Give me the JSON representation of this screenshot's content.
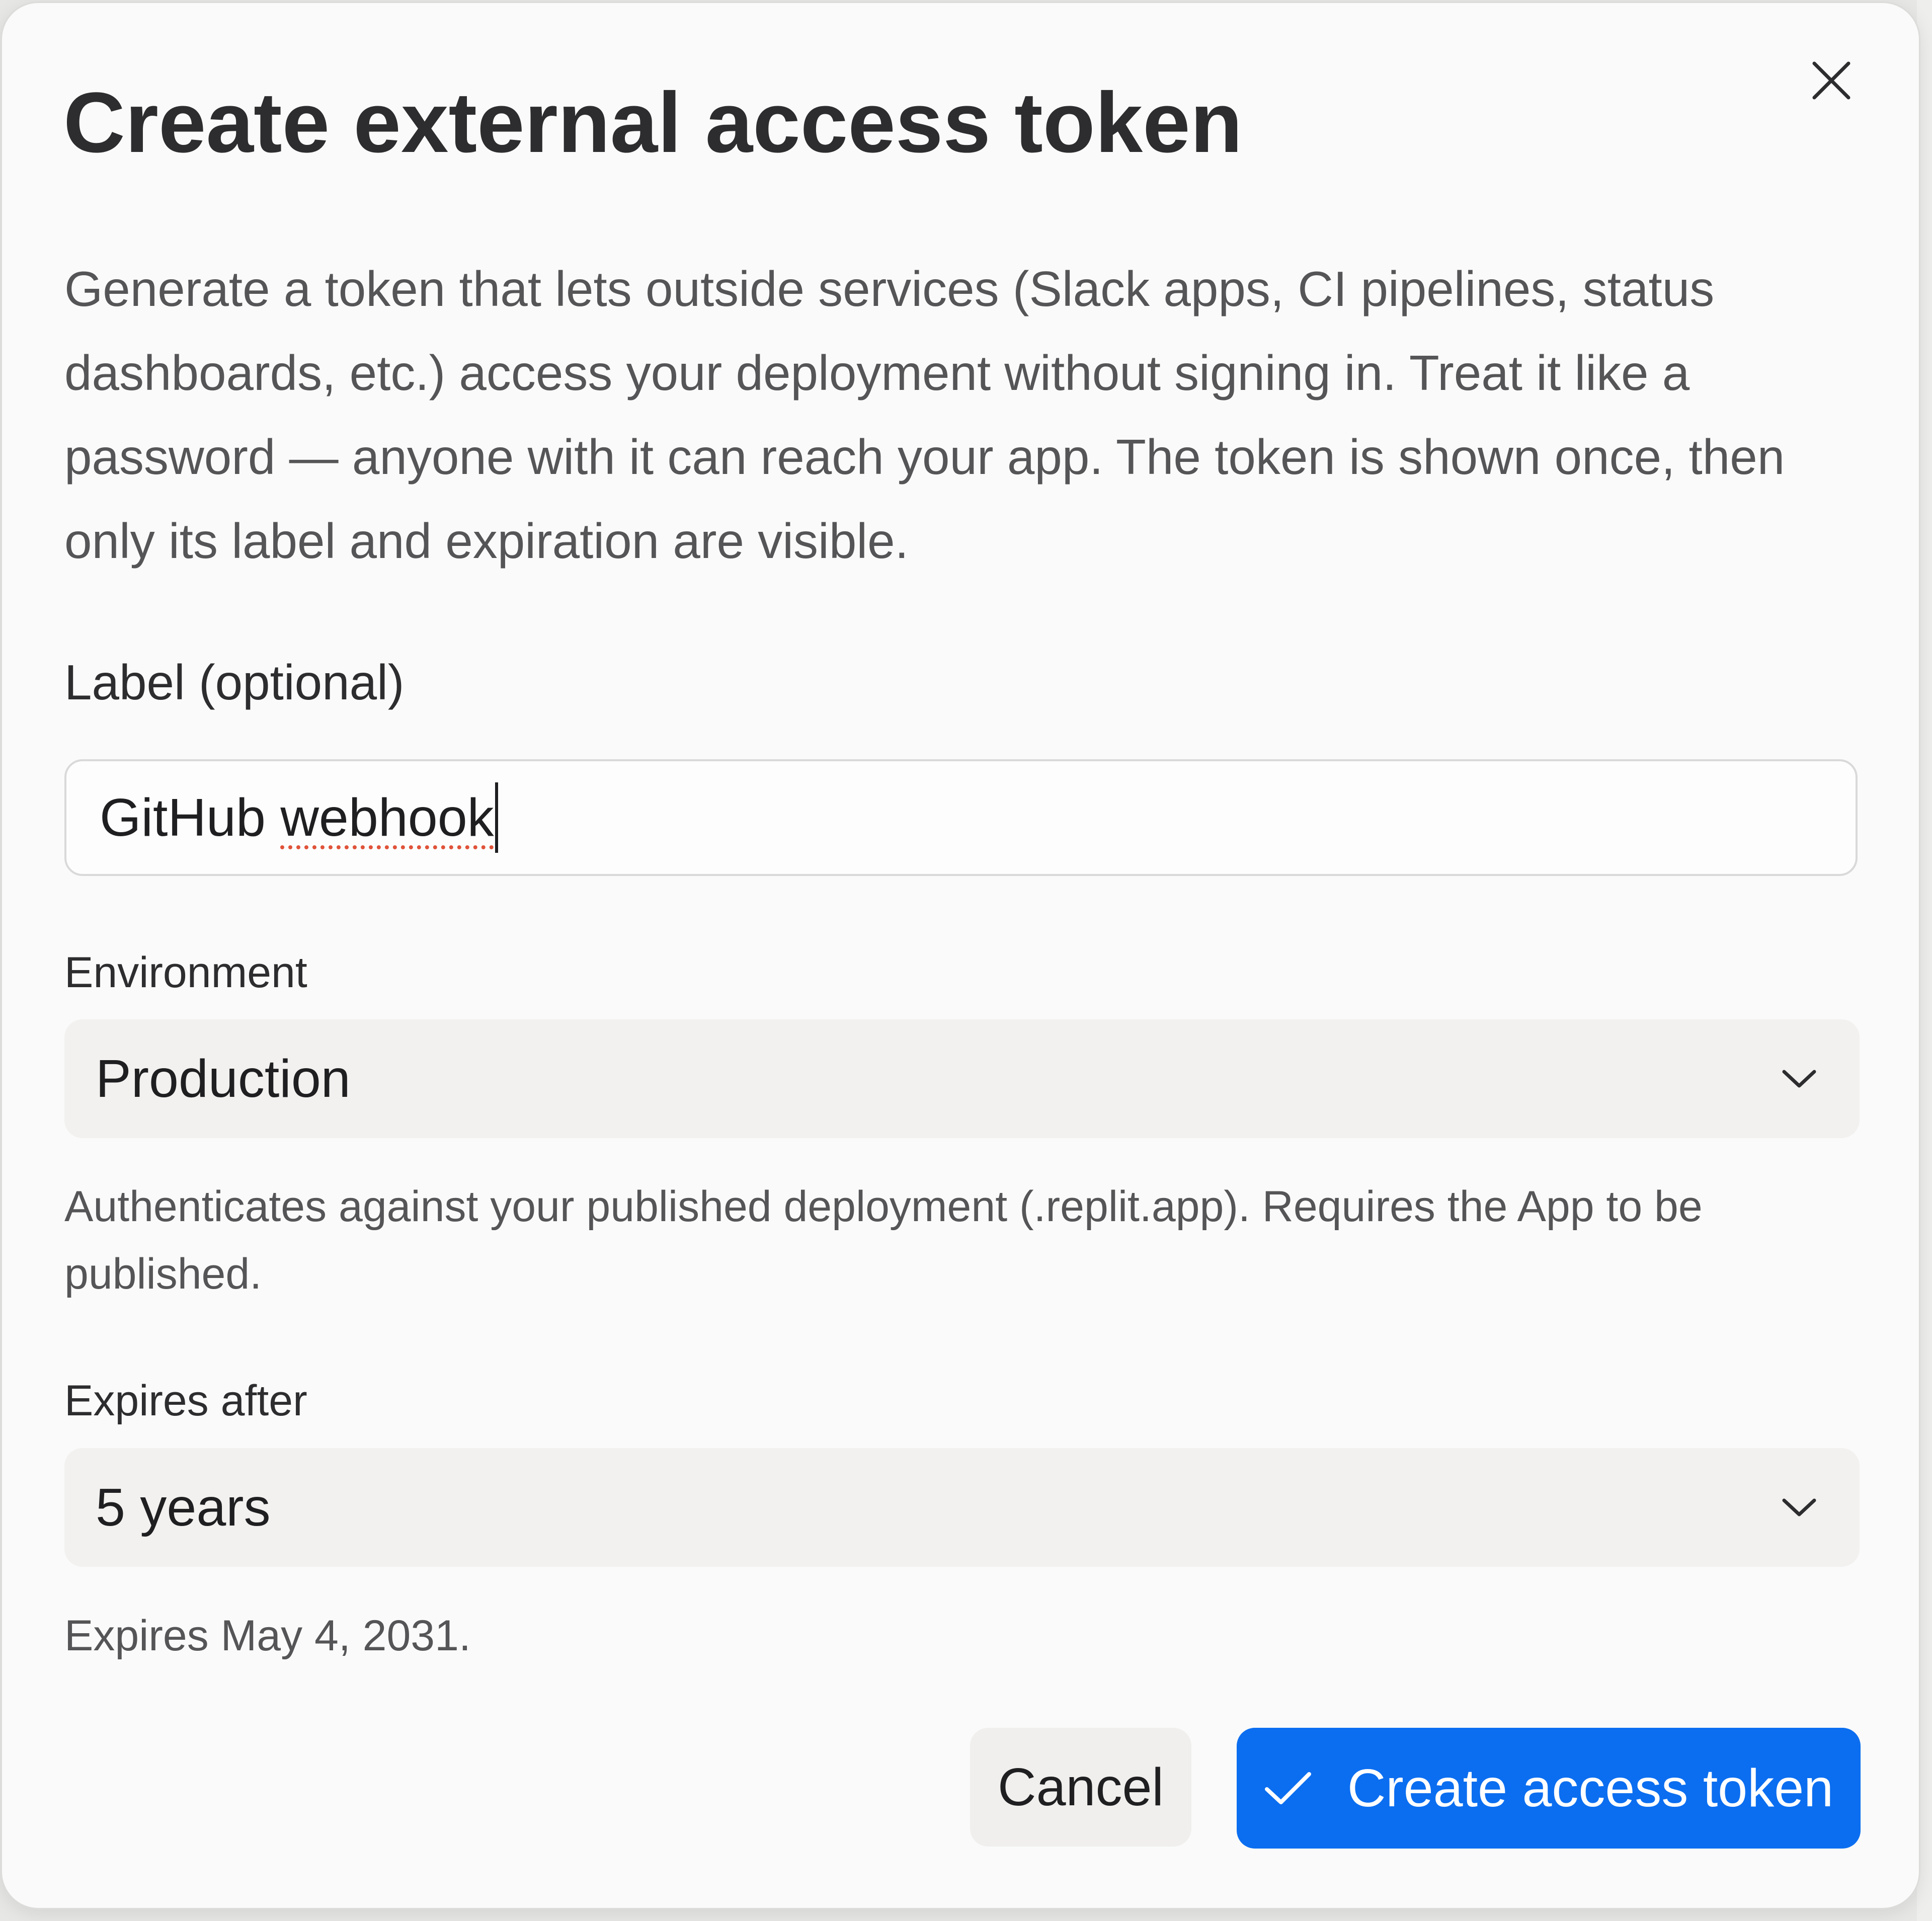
{
  "dialog": {
    "title": "Create external access token",
    "close_icon": "close-icon",
    "description": "Generate a token that lets outside services (Slack apps, CI pipelines, status dashboards, etc.) access your deployment without signing in. Treat it like a password — anyone with it can reach your app. The token is shown once, then only its label and expiration are visible."
  },
  "label_field": {
    "label": "Label (optional)",
    "value_first": "GitHub",
    "value_misspelled": "webhook"
  },
  "environment_field": {
    "label": "Environment",
    "selected": "Production",
    "chevron_icon": "chevron-down-icon",
    "help": "Authenticates against your published deployment (.replit.app). Requires the App to be published."
  },
  "expiry_field": {
    "label": "Expires after",
    "selected": "5 years",
    "chevron_icon": "chevron-down-icon",
    "help": "Expires May 4, 2031."
  },
  "actions": {
    "cancel_label": "Cancel",
    "create_label": "Create access token",
    "create_icon": "check-icon",
    "primary_color": "#0b6ef0"
  }
}
